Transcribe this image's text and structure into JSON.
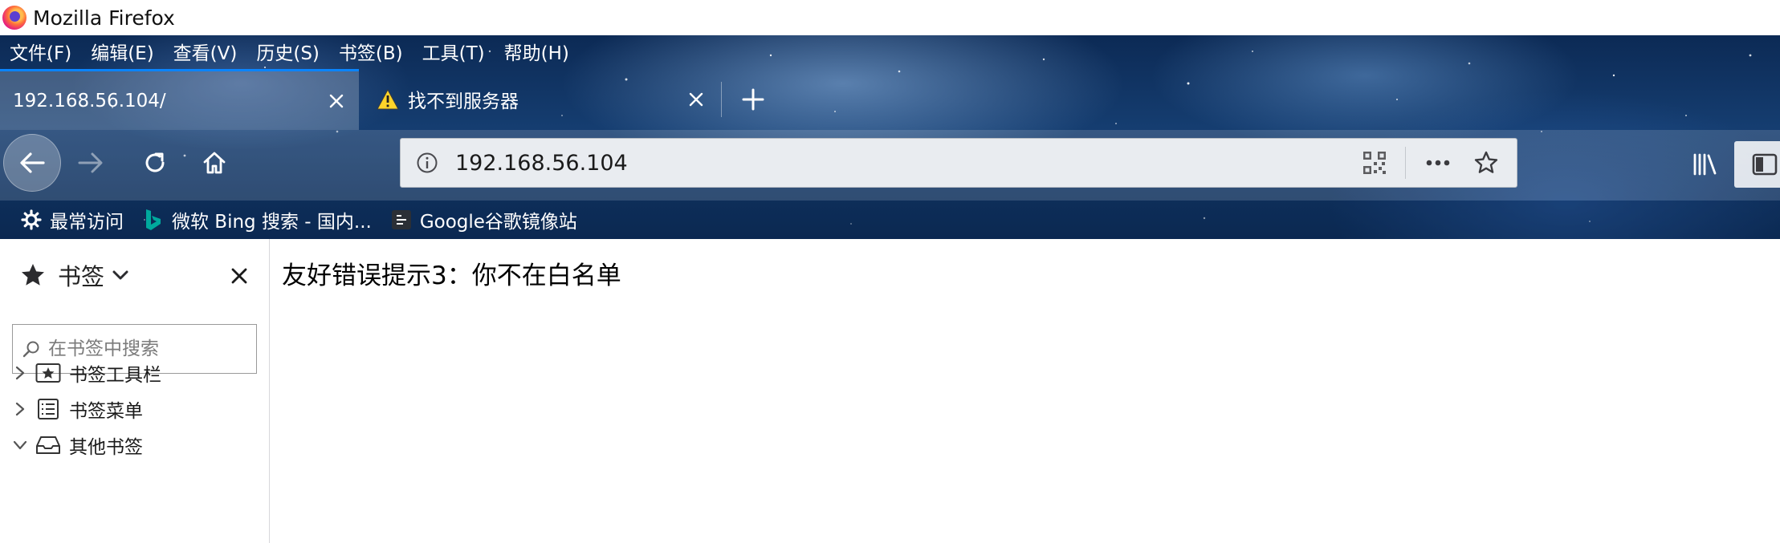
{
  "window": {
    "title": "Mozilla Firefox"
  },
  "menubar": {
    "items": [
      "文件(F)",
      "编辑(E)",
      "查看(V)",
      "历史(S)",
      "书签(B)",
      "工具(T)",
      "帮助(H)"
    ]
  },
  "tabs": [
    {
      "label": "192.168.56.104/",
      "active": true
    },
    {
      "label": "找不到服务器",
      "active": false,
      "icon": "warning-icon"
    }
  ],
  "navbar": {
    "url": "192.168.56.104"
  },
  "bookmarks_toolbar": {
    "items": [
      {
        "label": "最常访问",
        "icon": "gear-icon"
      },
      {
        "label": "微软 Bing 搜索 - 国内...",
        "icon": "bing-icon"
      },
      {
        "label": "Google谷歌镜像站",
        "icon": "site-icon"
      }
    ]
  },
  "sidebar": {
    "title": "书签",
    "search_placeholder": "在书签中搜索",
    "tree": [
      {
        "label": "书签工具栏",
        "expanded": false,
        "icon": "bookmark-toolbar-icon"
      },
      {
        "label": "书签菜单",
        "expanded": false,
        "icon": "bookmark-menu-icon"
      },
      {
        "label": "其他书签",
        "expanded": true,
        "icon": "other-bookmarks-icon"
      }
    ]
  },
  "content": {
    "text": "友好错误提示3：你不在白名单"
  },
  "colors": {
    "accent": "#0a84ff",
    "warning": "#ffd42a"
  }
}
